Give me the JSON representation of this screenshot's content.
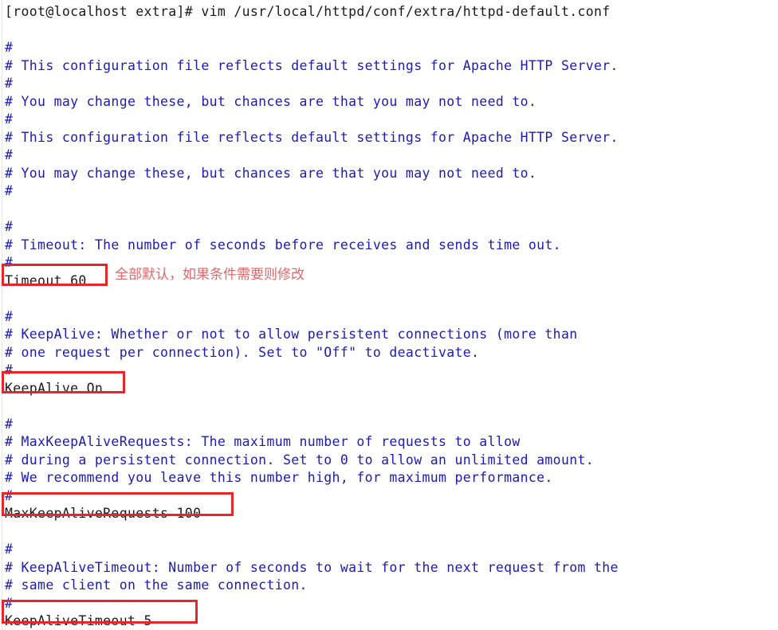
{
  "window": {
    "background_color": "#ffffff",
    "comment_color": "#1b1bb5",
    "text_color": "#1a1a1a",
    "annotation_box_color": "#e8252a",
    "annotation_text_color": "#e8656a"
  },
  "terminal": {
    "prompt_line": "[root@localhost extra]# vim /usr/local/httpd/conf/extra/httpd-default.conf",
    "lines": [
      {
        "text": "#",
        "kind": "comment"
      },
      {
        "text": "# This configuration file reflects default settings for Apache HTTP Server.",
        "kind": "comment"
      },
      {
        "text": "#",
        "kind": "comment"
      },
      {
        "text": "# You may change these, but chances are that you may not need to.",
        "kind": "comment"
      },
      {
        "text": "#",
        "kind": "comment"
      },
      {
        "text": "# This configuration file reflects default settings for Apache HTTP Server.",
        "kind": "comment"
      },
      {
        "text": "#",
        "kind": "comment"
      },
      {
        "text": "# You may change these, but chances are that you may not need to.",
        "kind": "comment"
      },
      {
        "text": "#",
        "kind": "comment"
      },
      {
        "text": "",
        "kind": "blank"
      },
      {
        "text": "#",
        "kind": "comment"
      },
      {
        "text": "# Timeout: The number of seconds before receives and sends time out.",
        "kind": "comment"
      },
      {
        "text": "#",
        "kind": "comment"
      },
      {
        "text": "Timeout 60",
        "kind": "directive"
      },
      {
        "text": "",
        "kind": "blank"
      },
      {
        "text": "#",
        "kind": "comment"
      },
      {
        "text": "# KeepAlive: Whether or not to allow persistent connections (more than",
        "kind": "comment"
      },
      {
        "text": "# one request per connection). Set to \"Off\" to deactivate.",
        "kind": "comment"
      },
      {
        "text": "#",
        "kind": "comment"
      },
      {
        "text": "KeepAlive On",
        "kind": "directive"
      },
      {
        "text": "",
        "kind": "blank"
      },
      {
        "text": "#",
        "kind": "comment"
      },
      {
        "text": "# MaxKeepAliveRequests: The maximum number of requests to allow",
        "kind": "comment"
      },
      {
        "text": "# during a persistent connection. Set to 0 to allow an unlimited amount.",
        "kind": "comment"
      },
      {
        "text": "# We recommend you leave this number high, for maximum performance.",
        "kind": "comment"
      },
      {
        "text": "#",
        "kind": "comment"
      },
      {
        "text": "MaxKeepAliveRequests 100",
        "kind": "directive"
      },
      {
        "text": "",
        "kind": "blank"
      },
      {
        "text": "#",
        "kind": "comment"
      },
      {
        "text": "# KeepAliveTimeout: Number of seconds to wait for the next request from the",
        "kind": "comment"
      },
      {
        "text": "# same client on the same connection.",
        "kind": "comment"
      },
      {
        "text": "#",
        "kind": "comment"
      },
      {
        "text": "KeepAliveTimeout 5",
        "kind": "directive"
      }
    ]
  },
  "annotations": {
    "note_timeout": "全部默认，如果条件需要则修改",
    "boxes": [
      {
        "label": "Timeout 60"
      },
      {
        "label": "KeepAlive On"
      },
      {
        "label": "MaxKeepAliveRequests 100"
      },
      {
        "label": "KeepAliveTimeout 5"
      }
    ]
  }
}
